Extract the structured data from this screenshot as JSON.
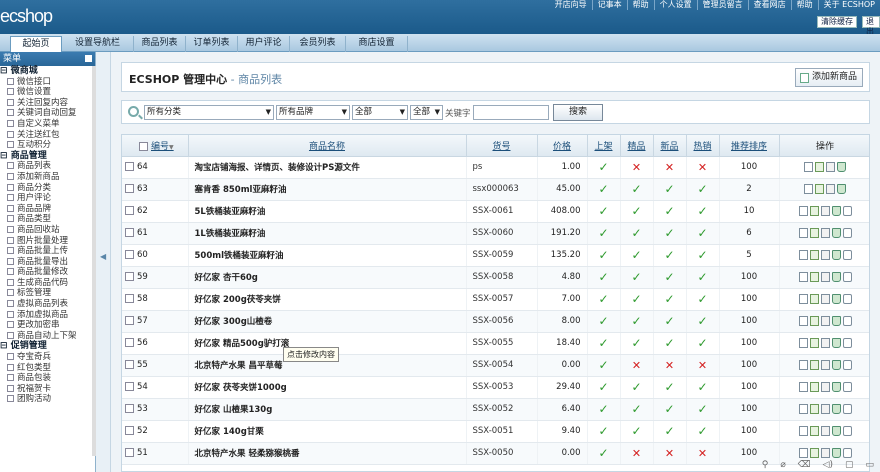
{
  "app": {
    "logo": "ecshop"
  },
  "top_links": [
    "开店向导",
    "记事本",
    "帮助",
    "个人设置",
    "管理员留言",
    "查看网店",
    "帮助",
    "关于 ECSHOP"
  ],
  "top_buttons": {
    "clear_cache": "清除缓存",
    "logout": "退出"
  },
  "nav_tabs": [
    "起始页",
    "设置导航栏",
    "商品列表",
    "订单列表",
    "用户评论",
    "会员列表",
    "商店设置"
  ],
  "sidebar": {
    "title": "菜单",
    "groups": [
      {
        "label": "微商城",
        "items": [
          "微信接口",
          "微信设置",
          "关注回复内容",
          "关键词自动回复",
          "自定义菜单",
          "关注送红包",
          "互动积分"
        ]
      },
      {
        "label": "商品管理",
        "items": [
          "商品列表",
          "添加新商品",
          "商品分类",
          "用户评论",
          "商品品牌",
          "商品类型",
          "商品回收站",
          "图片批量处理",
          "商品批量上传",
          "商品批量导出",
          "商品批量修改",
          "生成商品代码",
          "标签管理",
          "虚拟商品列表",
          "添加虚拟商品",
          "更改加密串",
          "商品自动上下架"
        ]
      },
      {
        "label": "促销管理",
        "items": [
          "夺宝奇兵",
          "红包类型",
          "商品包装",
          "祝福贺卡",
          "团购活动"
        ]
      }
    ]
  },
  "page": {
    "title": "ECSHOP 管理中心",
    "subtitle": " - 商品列表",
    "add_button": "添加新商品"
  },
  "search": {
    "category": "所有分类",
    "brand": "所有品牌",
    "filter1": "全部",
    "filter2": "全部",
    "keyword_label": "关键字",
    "keyword_value": "",
    "button": "搜索"
  },
  "table": {
    "headers": [
      "编号",
      "商品名称",
      "货号",
      "价格",
      "上架",
      "精品",
      "新品",
      "热销",
      "推荐排序",
      "操作"
    ],
    "rows": [
      {
        "id": "64",
        "name": "淘宝店铺海报、详情页、装修设计PS源文件",
        "sn": "ps",
        "price": "1.00",
        "on_sale": true,
        "best": false,
        "new": false,
        "hot": false,
        "sort": "100",
        "ops": [
          "view",
          "edit",
          "copy",
          "trash"
        ]
      },
      {
        "id": "63",
        "name": "塞肯香  850ml亚麻籽油",
        "sn": "ssx000063",
        "price": "45.00",
        "on_sale": true,
        "best": true,
        "new": true,
        "hot": true,
        "sort": "2",
        "ops": [
          "view",
          "edit",
          "copy",
          "trash"
        ]
      },
      {
        "id": "62",
        "name": "5L铁桶装亚麻籽油",
        "sn": "SSX-0061",
        "price": "408.00",
        "on_sale": true,
        "best": true,
        "new": true,
        "hot": true,
        "sort": "10",
        "ops": [
          "view",
          "edit",
          "copy",
          "trash",
          "link"
        ]
      },
      {
        "id": "61",
        "name": "1L铁桶装亚麻籽油",
        "sn": "SSX-0060",
        "price": "191.20",
        "on_sale": true,
        "best": true,
        "new": true,
        "hot": true,
        "sort": "6",
        "ops": [
          "view",
          "edit",
          "copy",
          "trash",
          "link"
        ]
      },
      {
        "id": "60",
        "name": "500ml铁桶装亚麻籽油",
        "sn": "SSX-0059",
        "price": "135.20",
        "on_sale": true,
        "best": true,
        "new": true,
        "hot": true,
        "sort": "5",
        "ops": [
          "view",
          "edit",
          "copy",
          "trash",
          "link"
        ]
      },
      {
        "id": "59",
        "name": "好亿家  杏干60g",
        "sn": "SSX-0058",
        "price": "4.80",
        "on_sale": true,
        "best": true,
        "new": true,
        "hot": true,
        "sort": "100",
        "ops": [
          "view",
          "edit",
          "copy",
          "trash",
          "link"
        ]
      },
      {
        "id": "58",
        "name": "好亿家  200g茯苓夹饼",
        "sn": "SSX-0057",
        "price": "7.00",
        "on_sale": true,
        "best": true,
        "new": true,
        "hot": true,
        "sort": "100",
        "ops": [
          "view",
          "edit",
          "copy",
          "trash",
          "link"
        ]
      },
      {
        "id": "57",
        "name": "好亿家  300g山楂卷",
        "sn": "SSX-0056",
        "price": "8.00",
        "on_sale": true,
        "best": true,
        "new": true,
        "hot": true,
        "sort": "100",
        "ops": [
          "view",
          "edit",
          "copy",
          "trash",
          "link"
        ]
      },
      {
        "id": "56",
        "name": "好亿家  精品500g驴打滚",
        "sn": "SSX-0055",
        "price": "18.40",
        "on_sale": true,
        "best": true,
        "new": true,
        "hot": true,
        "sort": "100",
        "ops": [
          "view",
          "edit",
          "copy",
          "trash",
          "link"
        ]
      },
      {
        "id": "55",
        "name": "北京特产水果  昌平草莓",
        "sn": "SSX-0054",
        "price": "0.00",
        "on_sale": true,
        "best": false,
        "new": false,
        "hot": false,
        "sort": "100",
        "ops": [
          "view",
          "edit",
          "copy",
          "trash",
          "link"
        ]
      },
      {
        "id": "54",
        "name": "好亿家  茯苓夹饼1000g",
        "sn": "SSX-0053",
        "price": "29.40",
        "on_sale": true,
        "best": true,
        "new": true,
        "hot": true,
        "sort": "100",
        "ops": [
          "view",
          "edit",
          "copy",
          "trash",
          "link"
        ]
      },
      {
        "id": "53",
        "name": "好亿家  山楂果130g",
        "sn": "SSX-0052",
        "price": "6.40",
        "on_sale": true,
        "best": true,
        "new": true,
        "hot": true,
        "sort": "100",
        "ops": [
          "view",
          "edit",
          "copy",
          "trash",
          "link"
        ]
      },
      {
        "id": "52",
        "name": "好亿家  140g甘栗",
        "sn": "SSX-0051",
        "price": "9.40",
        "on_sale": true,
        "best": true,
        "new": true,
        "hot": true,
        "sort": "100",
        "ops": [
          "view",
          "edit",
          "copy",
          "trash",
          "link"
        ]
      },
      {
        "id": "51",
        "name": "北京特产水果  轻柔猕猴桃番",
        "sn": "SSX-0050",
        "price": "0.00",
        "on_sale": true,
        "best": false,
        "new": false,
        "hot": false,
        "sort": "100",
        "ops": [
          "view",
          "edit",
          "copy",
          "trash",
          "link"
        ]
      }
    ]
  },
  "tooltip": "点击修改内容",
  "tray_icons": [
    "pin-icon",
    "network-icon",
    "trash-icon",
    "volume-icon",
    "window-icon",
    "chat-icon"
  ],
  "colors": {
    "topbar": "#2f6f9f",
    "check": "#2e9a2e",
    "cross": "#d42020",
    "link": "#1c4f7a"
  }
}
